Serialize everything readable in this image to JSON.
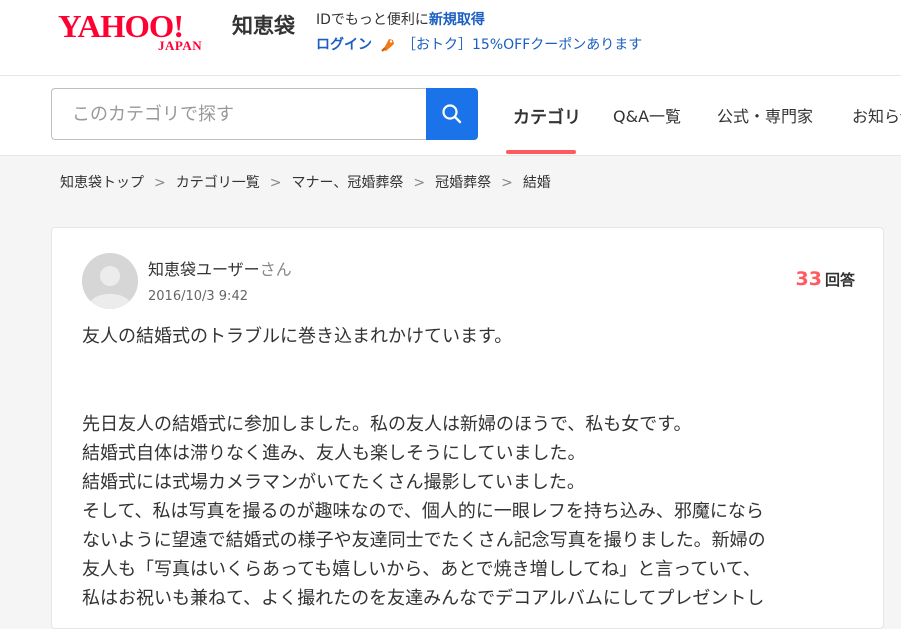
{
  "header": {
    "logo_main": "YAHOO!",
    "logo_sub": "JAPAN",
    "service_name": "知恵袋",
    "info_prefix": "IDでもっと便利に",
    "register_link": "新規取得",
    "login_link": "ログイン",
    "coupon_text": "［おトク］15%OFFクーポンあります",
    "brand_color": "#ff0033"
  },
  "search": {
    "placeholder": "このカテゴリで探す",
    "icon": "search-icon"
  },
  "nav": {
    "items": [
      {
        "label": "カテゴリ",
        "active": true
      },
      {
        "label": "Q&A一覧",
        "active": false
      },
      {
        "label": "公式・専門家",
        "active": false
      },
      {
        "label": "お知らせ",
        "active": false
      }
    ]
  },
  "breadcrumb": {
    "items": [
      "知恵袋トップ",
      "カテゴリ一覧",
      "マナー、冠婚葬祭",
      "冠婚葬祭",
      "結婚"
    ],
    "separator": ">"
  },
  "question": {
    "user_name": "知恵袋ユーザー",
    "user_suffix": "さん",
    "date": "2016/10/3 9:42",
    "answer_count": "33",
    "answer_label": "回答",
    "title": "友人の結婚式のトラブルに巻き込まれかけています。",
    "body_lines": [
      "先日友人の結婚式に参加しました。私の友人は新婦のほうで、私も女です。",
      "結婚式自体は滞りなく進み、友人も楽しそうにしていました。",
      "結婚式には式場カメラマンがいてたくさん撮影していました。",
      "そして、私は写真を撮るのが趣味なので、個人的に一眼レフを持ち込み、邪魔になら",
      "ないように望遠で結婚式の様子や友達同士でたくさん記念写真を撮りました。新婦の",
      "友人も「写真はいくらあっても嬉しいから、あとで焼き増ししてね」と言っていて、",
      "私はお祝いも兼ねて、よく撮れたのを友達みんなでデコアルバムにしてプレゼントし"
    ],
    "accent_color": "#ff5a5f"
  }
}
